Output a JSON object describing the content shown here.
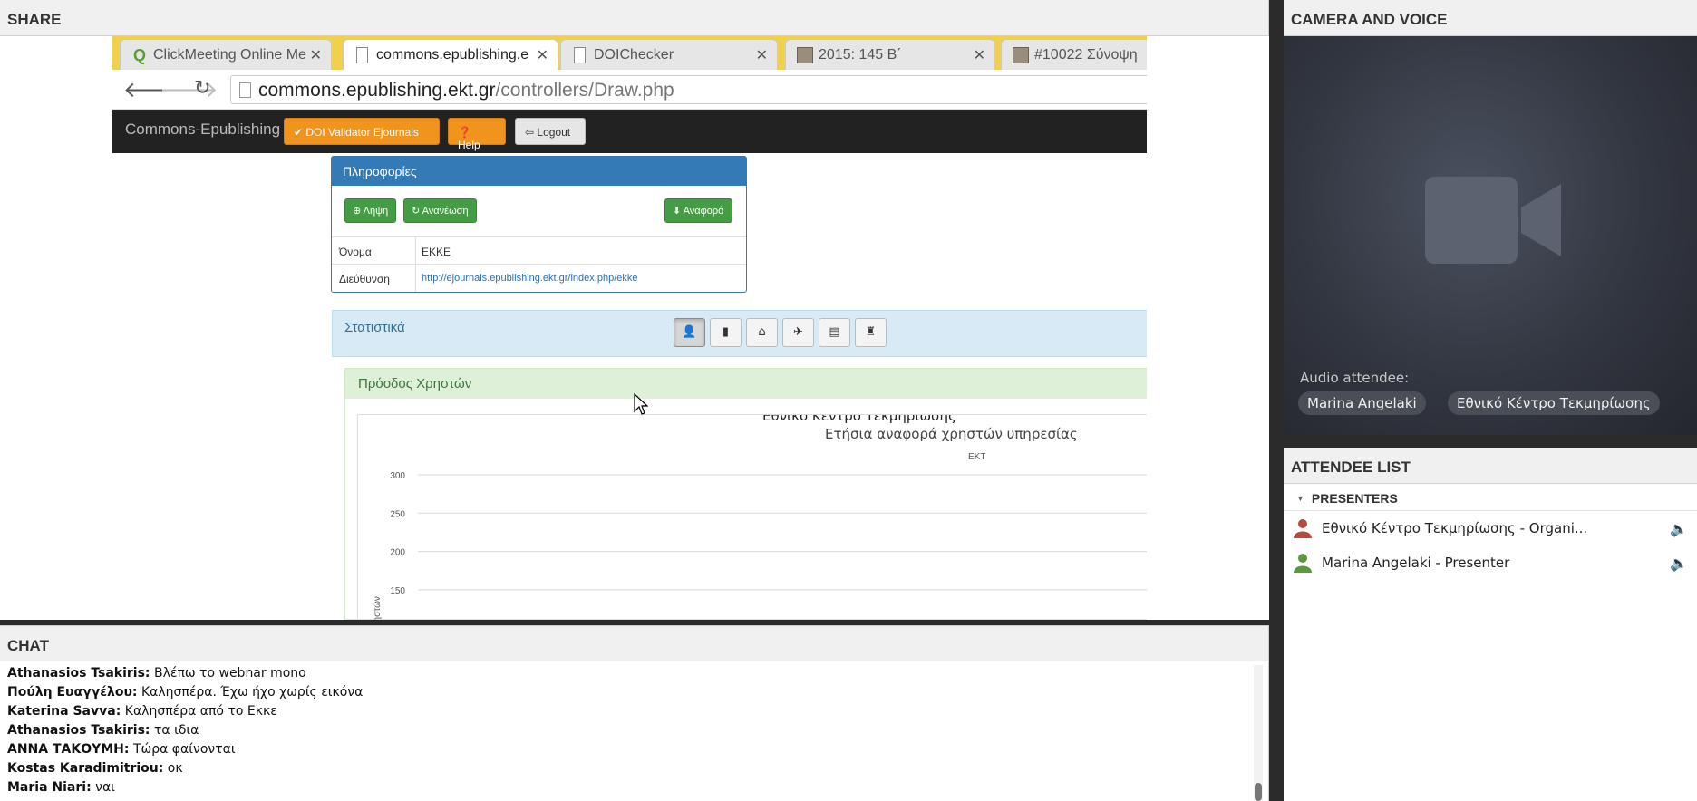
{
  "share": {
    "title": "SHARE",
    "browser": {
      "tabs": [
        {
          "label": "ClickMeeting Online Me",
          "icon": "clickmeeting-favicon-icon",
          "active": false
        },
        {
          "label": "commons.epublishing.e",
          "icon": "page-favicon-icon",
          "active": true
        },
        {
          "label": "DOIChecker",
          "icon": "page-favicon-icon",
          "active": false
        },
        {
          "label": "2015: 145 Β΄",
          "icon": "image-favicon-icon",
          "active": false
        },
        {
          "label": "#10022 Σύνοψη",
          "icon": "image-favicon-icon",
          "active": false
        }
      ],
      "url_host": "commons.epublishing.ekt.gr",
      "url_path": "/controllers/Draw.php"
    },
    "site": {
      "brand": "Commons-Epublishing",
      "nav": {
        "validator": "✔ DOI Validator Ejournals",
        "help": "❓ Help",
        "logout": "⇦ Logout"
      },
      "info": {
        "title": "Πληροφορίες",
        "btn_fetch": "⊕ Λήψη",
        "btn_refresh": "↻ Ανανέωση",
        "btn_report": "⬇ Αναφορά",
        "rows": [
          {
            "key": "Όνομα",
            "value": "ΕΚΚΕ"
          },
          {
            "key": "Διεύθυνση",
            "value": "http://ejournals.epublishing.ekt.gr/index.php/ekke"
          }
        ]
      },
      "stats_title": "Στατιστικά",
      "stats_icons": [
        "user-icon",
        "book-icon",
        "inbox-icon",
        "plane-icon",
        "printer-icon",
        "lamp-icon"
      ],
      "chart_panel_title": "Πρόοδος Χρηστών"
    }
  },
  "chart_data": {
    "type": "line",
    "title": "Εθνικό Κέντρο Τεκμηρίωσης",
    "subtitle": "Ετήσια αναφορά χρηστών υπηρεσίας",
    "legend_label": "ΕΚΤ",
    "ylabel": "Αριθμός Χρηστών",
    "yticks": [
      300,
      250,
      200,
      150
    ],
    "ylim": [
      150,
      300
    ],
    "grid": true
  },
  "camera": {
    "title": "CAMERA AND VOICE",
    "audio_label": "Audio attendee:",
    "attendees_audio": [
      "Marina Angelaki",
      "Εθνικό Κέντρο Τεκμηρίωσης"
    ]
  },
  "attendee_list": {
    "title": "ATTENDEE LIST",
    "section": "PRESENTERS",
    "people": [
      {
        "name": "Εθνικό Κέντρο Τεκμηρίωσης - Organi...",
        "color": "#b84a3e"
      },
      {
        "name": "Marina Angelaki - Presenter",
        "color": "#5a9a3a"
      }
    ]
  },
  "chat": {
    "title": "CHAT",
    "messages": [
      {
        "author": "Athanasios Tsakiris:",
        "text": "Βλέπω το webnar mono"
      },
      {
        "author": "Πούλη Ευαγγέλου:",
        "text": "Καλησπέρα. Έχω ήχο χωρίς εικόνα"
      },
      {
        "author": "Katerina Savva:",
        "text": "Καλησπέρα από το Εκκε"
      },
      {
        "author": "Athanasios Tsakiris:",
        "text": "τα ιδια"
      },
      {
        "author": "ΑΝΝΑ ΤΑΚΟΥΜΗ:",
        "text": "Τώρα φαίνονται"
      },
      {
        "author": "Kostas Karadimitriou:",
        "text": "οκ"
      },
      {
        "author": "Maria Niari:",
        "text": "ναι"
      }
    ]
  }
}
